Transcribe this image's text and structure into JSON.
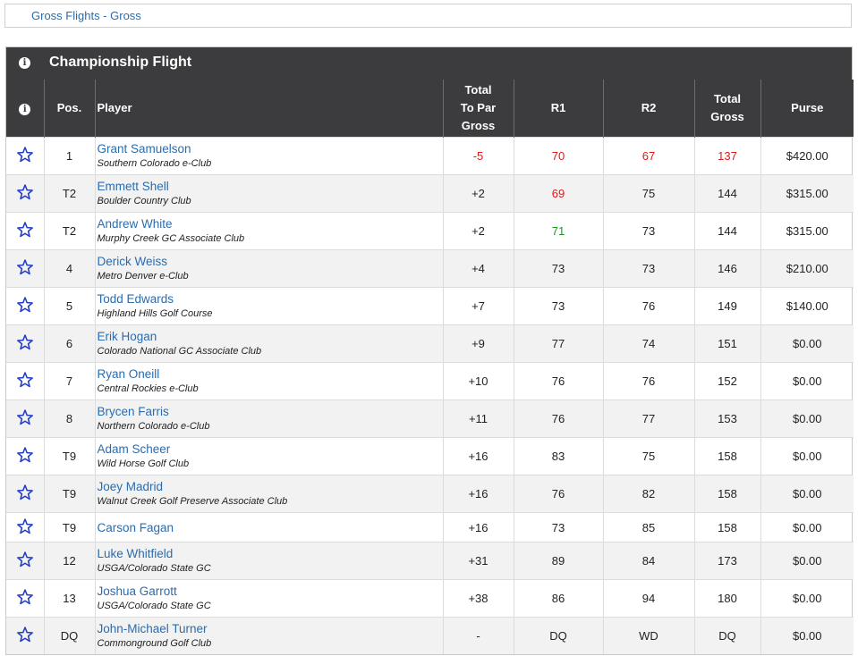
{
  "nav": {
    "link": "Gross Flights - Gross"
  },
  "board": {
    "title": "Championship Flight"
  },
  "columns": {
    "pos": "Pos.",
    "player": "Player",
    "total_to_par": [
      "Total",
      "To Par",
      "Gross"
    ],
    "r1": "R1",
    "r2": "R2",
    "total_gross": [
      "Total",
      "Gross"
    ],
    "purse": "Purse"
  },
  "colors": {
    "under_par": "#e0191b",
    "birdie": "#1a9a24",
    "link": "#2a6cae",
    "header_bg": "#3c3b3d",
    "star": "#1f3bc7"
  },
  "icons": {
    "info": "info-circle-icon",
    "favorite": "star-outline-icon"
  },
  "rows": [
    {
      "pos": "1",
      "name": "Grant Samuelson",
      "club": "Southern Colorado e-Club",
      "to_par": "-5",
      "r1": "70",
      "r2": "67",
      "total": "137",
      "purse": "$420.00",
      "to_par_style": "red",
      "r1_style": "red",
      "r2_style": "red",
      "total_style": "red"
    },
    {
      "pos": "T2",
      "name": "Emmett Shell",
      "club": "Boulder Country Club",
      "to_par": "+2",
      "r1": "69",
      "r2": "75",
      "total": "144",
      "purse": "$315.00",
      "r1_style": "red"
    },
    {
      "pos": "T2",
      "name": "Andrew White",
      "club": "Murphy Creek GC Associate Club",
      "to_par": "+2",
      "r1": "71",
      "r2": "73",
      "total": "144",
      "purse": "$315.00",
      "r1_style": "green"
    },
    {
      "pos": "4",
      "name": "Derick Weiss",
      "club": "Metro Denver e-Club",
      "to_par": "+4",
      "r1": "73",
      "r2": "73",
      "total": "146",
      "purse": "$210.00"
    },
    {
      "pos": "5",
      "name": "Todd Edwards",
      "club": "Highland Hills Golf Course",
      "to_par": "+7",
      "r1": "73",
      "r2": "76",
      "total": "149",
      "purse": "$140.00"
    },
    {
      "pos": "6",
      "name": "Erik Hogan",
      "club": "Colorado National GC Associate Club",
      "to_par": "+9",
      "r1": "77",
      "r2": "74",
      "total": "151",
      "purse": "$0.00"
    },
    {
      "pos": "7",
      "name": "Ryan Oneill",
      "club": "Central Rockies e-Club",
      "to_par": "+10",
      "r1": "76",
      "r2": "76",
      "total": "152",
      "purse": "$0.00"
    },
    {
      "pos": "8",
      "name": "Brycen Farris",
      "club": "Northern Colorado e-Club",
      "to_par": "+11",
      "r1": "76",
      "r2": "77",
      "total": "153",
      "purse": "$0.00"
    },
    {
      "pos": "T9",
      "name": "Adam Scheer",
      "club": "Wild Horse Golf Club",
      "to_par": "+16",
      "r1": "83",
      "r2": "75",
      "total": "158",
      "purse": "$0.00"
    },
    {
      "pos": "T9",
      "name": "Joey Madrid",
      "club": "Walnut Creek Golf Preserve Associate Club",
      "to_par": "+16",
      "r1": "76",
      "r2": "82",
      "total": "158",
      "purse": "$0.00"
    },
    {
      "pos": "T9",
      "name": "Carson Fagan",
      "club": "",
      "to_par": "+16",
      "r1": "73",
      "r2": "85",
      "total": "158",
      "purse": "$0.00"
    },
    {
      "pos": "12",
      "name": "Luke Whitfield",
      "club": "USGA/Colorado State GC",
      "to_par": "+31",
      "r1": "89",
      "r2": "84",
      "total": "173",
      "purse": "$0.00"
    },
    {
      "pos": "13",
      "name": "Joshua Garrott",
      "club": "USGA/Colorado State GC",
      "to_par": "+38",
      "r1": "86",
      "r2": "94",
      "total": "180",
      "purse": "$0.00"
    },
    {
      "pos": "DQ",
      "name": "John-Michael Turner",
      "club": "Commonground Golf Club",
      "to_par": "-",
      "r1": "DQ",
      "r2": "WD",
      "total": "DQ",
      "purse": "$0.00"
    }
  ]
}
